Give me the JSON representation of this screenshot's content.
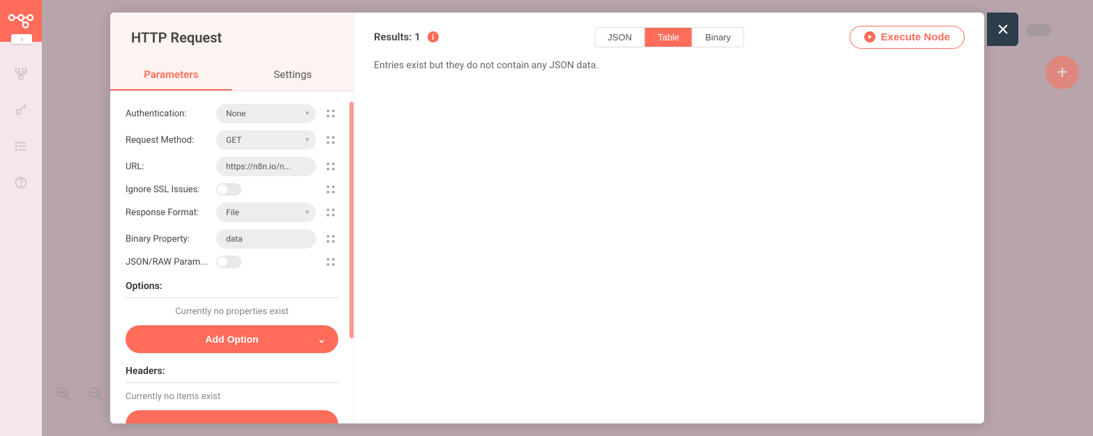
{
  "sidebar": {
    "icons": [
      "workflow-icon",
      "workflows-icon",
      "key-icon",
      "list-icon",
      "help-icon"
    ]
  },
  "modal": {
    "title": "HTTP Request",
    "tabs": {
      "parameters": "Parameters",
      "settings": "Settings",
      "active": "parameters"
    },
    "params": {
      "authentication": {
        "label": "Authentication:",
        "value": "None"
      },
      "requestMethod": {
        "label": "Request Method:",
        "value": "GET"
      },
      "url": {
        "label": "URL:",
        "value": "https://n8n.io/n..."
      },
      "ignoreSsl": {
        "label": "Ignore SSL Issues:",
        "value": false
      },
      "responseFormat": {
        "label": "Response Format:",
        "value": "File"
      },
      "binaryProperty": {
        "label": "Binary Property:",
        "value": "data"
      },
      "jsonRaw": {
        "label": "JSON/RAW Param...",
        "value": false
      }
    },
    "options": {
      "header": "Options:",
      "empty": "Currently no properties exist",
      "addBtn": "Add Option"
    },
    "headers": {
      "header": "Headers:",
      "empty": "Currently no items exist"
    }
  },
  "right": {
    "resultsLabel": "Results: 1",
    "views": {
      "json": "JSON",
      "table": "Table",
      "binary": "Binary",
      "active": "table"
    },
    "executeBtn": "Execute Node",
    "emptyMsg": "Entries exist but they do not contain any JSON data."
  }
}
